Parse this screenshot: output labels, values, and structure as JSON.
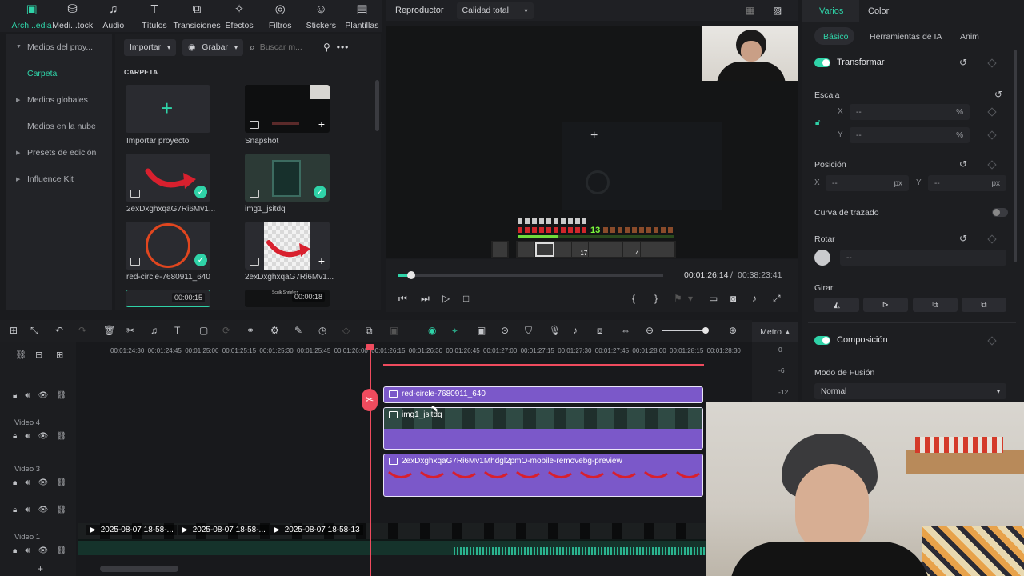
{
  "topbar": {
    "items": [
      {
        "label": "Arch...edia",
        "icon": "archive-icon",
        "glyph": "▣",
        "active": true
      },
      {
        "label": "Medi...tock",
        "icon": "media-stock-icon",
        "glyph": "⛁"
      },
      {
        "label": "Audio",
        "icon": "music-note-icon",
        "glyph": "♫"
      },
      {
        "label": "Títulos",
        "icon": "text-t-icon",
        "glyph": "T"
      },
      {
        "label": "Transiciones",
        "icon": "transition-icon",
        "glyph": "⧉"
      },
      {
        "label": "Efectos",
        "icon": "sparkle-icon",
        "glyph": "✧"
      },
      {
        "label": "Filtros",
        "icon": "filter-icon",
        "glyph": "◎"
      },
      {
        "label": "Stickers",
        "icon": "sticker-icon",
        "glyph": "☺"
      },
      {
        "label": "Plantillas",
        "icon": "template-icon",
        "glyph": "▤"
      }
    ]
  },
  "leftnav": {
    "items": [
      {
        "label": "Medios del proy...",
        "type": "expanded"
      },
      {
        "label": "Carpeta",
        "type": "active"
      },
      {
        "label": "Medios globales",
        "type": "collapsed"
      },
      {
        "label": "Medios en la nube",
        "type": "plain"
      },
      {
        "label": "Presets de edición",
        "type": "collapsed"
      },
      {
        "label": "Influence Kit",
        "type": "collapsed"
      }
    ]
  },
  "mediatools": {
    "import_label": "Importar",
    "record_label": "Grabar",
    "search_placeholder": "Buscar m..."
  },
  "library": {
    "folder_heading": "CARPETA",
    "items": [
      {
        "name": "Importar proyecto"
      },
      {
        "name": "Snapshot"
      },
      {
        "name": "2exDxghxqaG7Ri6Mv1..."
      },
      {
        "name": "img1_jsitdq"
      },
      {
        "name": "red-circle-7680911_640"
      },
      {
        "name": "2exDxghxqaG7Ri6Mv1..."
      }
    ],
    "partial_durations": [
      "00:00:15",
      "00:00:18"
    ],
    "partial_caption": "Sculk Shrieker"
  },
  "player": {
    "label": "Reproductor",
    "quality": "Calidad total",
    "hud_level": "13",
    "hotbar_counts": [
      "17",
      "4"
    ],
    "current_time": "00:01:26:14",
    "separator": "/",
    "total_time": "00:38:23:41",
    "progress_percent": 5
  },
  "props": {
    "tabs": [
      "Varios",
      "Color"
    ],
    "subtabs": [
      "Básico",
      "Herramientas de IA",
      "Anim"
    ],
    "transform_label": "Transformar",
    "scale_label": "Escala",
    "x_label": "X",
    "y_label": "Y",
    "empty_value": "--",
    "percent_unit": "%",
    "px_unit": "px",
    "position_label": "Posición",
    "curve_label": "Curva de trazado",
    "rotate_label": "Rotar",
    "flip_label": "Girar",
    "composition_label": "Composición",
    "blend_label": "Modo de Fusión",
    "blend_value": "Normal"
  },
  "timeline": {
    "metro_label": "Metro",
    "meter_labels": [
      "0",
      "-6",
      "-12"
    ],
    "ruler_ticks": [
      "00:01:24:30",
      "00:01:24:45",
      "00:01:25:00",
      "00:01:25:15",
      "00:01:25:30",
      "00:01:25:45",
      "00:01:26:00",
      "00:01:26:15",
      "00:01:26:30",
      "00:01:26:45",
      "00:01:27:00",
      "00:01:27:15",
      "00:01:27:30",
      "00:01:27:45",
      "00:01:28:00",
      "00:01:28:15",
      "00:01:28:30"
    ],
    "track_names": [
      "Video 4",
      "Video 3",
      "Video 1"
    ],
    "clips": {
      "red_circle": "red-circle-7680911_640",
      "img1": "img1_jsitdq",
      "arrow": "2exDxghxqaG7Ri6Mv1Mhdgl2pmO-mobile-removebg-preview"
    },
    "video1_clips": [
      "2025-08-07 18-58-...",
      "2025-08-07 18-58-...",
      "2025-08-07 18-58-13"
    ],
    "add_track": "+"
  },
  "colors": {
    "accent": "#2fd3a8",
    "clip": "#7b58c9",
    "playhead": "#ef4b5e"
  }
}
